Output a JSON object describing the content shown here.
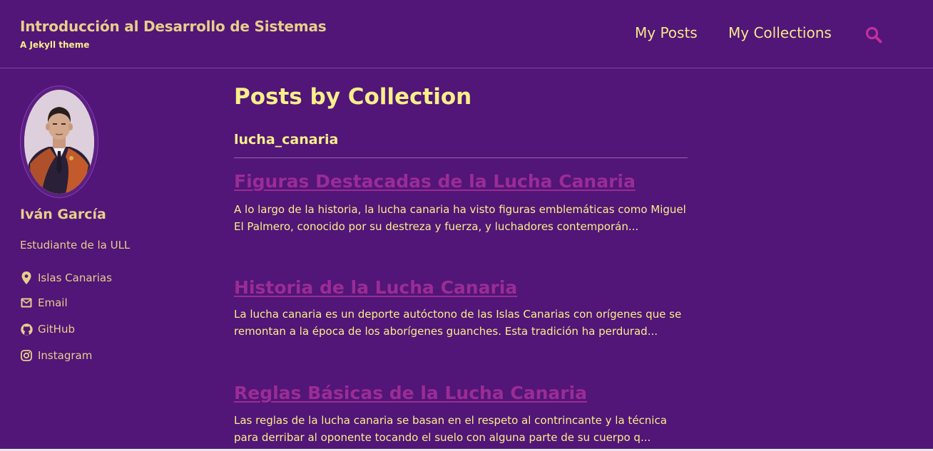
{
  "header": {
    "site_title": "Introducción al Desarrollo de Sistemas",
    "site_subtitle": "A Jekyll theme",
    "nav": [
      {
        "label": "My Posts"
      },
      {
        "label": "My Collections"
      }
    ],
    "search_icon": "search-icon"
  },
  "sidebar": {
    "author_name": "Iván García",
    "author_bio": "Estudiante de la ULL",
    "links": [
      {
        "icon": "location-icon",
        "label": "Islas Canarias"
      },
      {
        "icon": "email-icon",
        "label": "Email"
      },
      {
        "icon": "github-icon",
        "label": "GitHub"
      },
      {
        "icon": "instagram-icon",
        "label": "Instagram"
      }
    ]
  },
  "main": {
    "page_title": "Posts by Collection",
    "collection_name": "lucha_canaria",
    "posts": [
      {
        "title": "Figuras Destacadas de la Lucha Canaria",
        "excerpt": "A lo largo de la historia, la lucha canaria ha visto figuras emblemáticas como Miguel El Palmero, conocido por su destreza y fuerza, y luchadores contemporán..."
      },
      {
        "title": "Historia de la Lucha Canaria",
        "excerpt": "La lucha canaria es un deporte autóctono de las Islas Canarias con orígenes que se remontan a la época de los aborígenes guanches. Esta tradición ha perdurad..."
      },
      {
        "title": "Reglas Básicas de la Lucha Canaria",
        "excerpt": "Las reglas de la lucha canaria se basan en el respeto al contrincante y la técnica para derribar al oponente tocando el suelo con alguna parte de su cuerpo q..."
      }
    ]
  },
  "colors": {
    "background": "#521578",
    "title_gold": "#e6cf8a",
    "text_yellow": "#f7ef8a",
    "link_magenta": "#9b2c95",
    "search_icon": "#c2309e"
  }
}
